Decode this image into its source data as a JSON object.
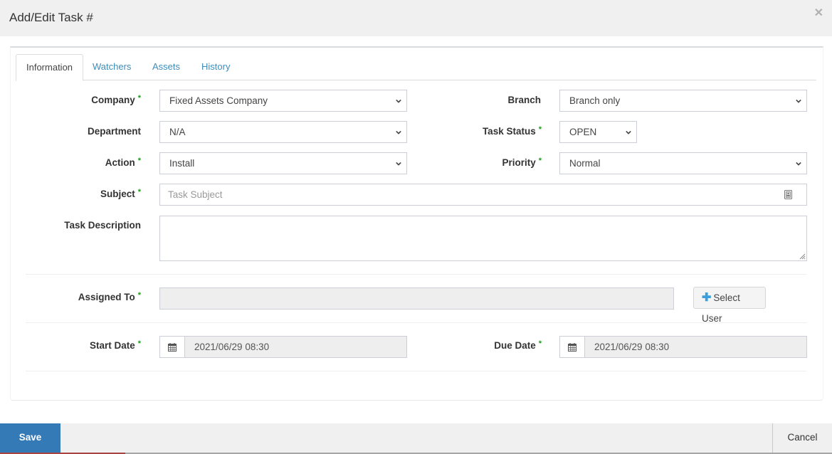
{
  "header": {
    "title": "Add/Edit Task #",
    "close_icon": "times-icon"
  },
  "tabs": [
    {
      "label": "Information",
      "active": true
    },
    {
      "label": "Watchers",
      "active": false
    },
    {
      "label": "Assets",
      "active": false
    },
    {
      "label": "History",
      "active": false
    }
  ],
  "form": {
    "company": {
      "label": "Company",
      "required": true,
      "value": "Fixed Assets Company"
    },
    "branch": {
      "label": "Branch",
      "required": false,
      "value": "Branch only"
    },
    "department": {
      "label": "Department",
      "required": false,
      "value": "N/A"
    },
    "task_status": {
      "label": "Task Status",
      "required": true,
      "value": "OPEN"
    },
    "action": {
      "label": "Action",
      "required": true,
      "value": "Install"
    },
    "priority": {
      "label": "Priority",
      "required": true,
      "value": "Normal"
    },
    "subject": {
      "label": "Subject",
      "required": true,
      "value": "",
      "placeholder": "Task Subject",
      "icon": "contact-card-icon"
    },
    "task_description": {
      "label": "Task Description",
      "required": false,
      "value": ""
    },
    "assigned_to": {
      "label": "Assigned To",
      "required": true,
      "value": "",
      "button_label": "Select User"
    },
    "start_date": {
      "label": "Start Date",
      "required": true,
      "value": "2021/06/29 08:30"
    },
    "due_date": {
      "label": "Due Date",
      "required": true,
      "value": "2021/06/29 08:30"
    },
    "required_marker": "*"
  },
  "footer": {
    "save_label": "Save",
    "cancel_label": "Cancel"
  },
  "colors": {
    "primary": "#337ab7",
    "link": "#3c8dbc",
    "required": "#1a9b1a",
    "header_bg": "#f0f0f0"
  }
}
